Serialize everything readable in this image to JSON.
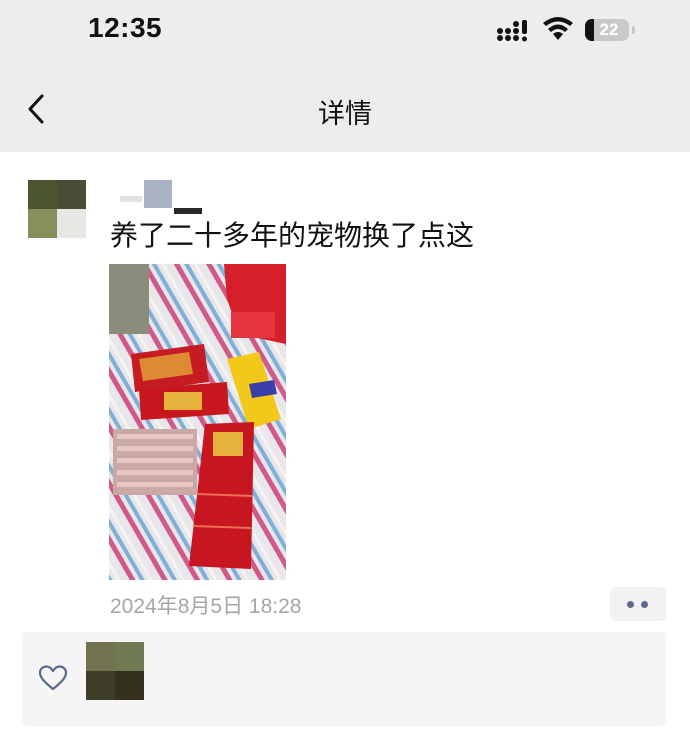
{
  "status_bar": {
    "time": "12:35",
    "battery_level": "22",
    "icons": [
      "signal-icon",
      "wifi-icon",
      "battery-icon"
    ]
  },
  "nav": {
    "title": "详情",
    "back_icon": "chevron-left-icon"
  },
  "post": {
    "text": "养了二十多年的宠物换了点这",
    "timestamp": "2024年8月5日 18:28",
    "more_icon": "more-dots-icon"
  },
  "likes": {
    "icon": "heart-icon"
  },
  "colors": {
    "header_bg": "#ededed",
    "link_blue": "#5a6a8c",
    "timestamp_gray": "#a6a6a6",
    "likes_panel_bg": "#f5f5f5"
  }
}
